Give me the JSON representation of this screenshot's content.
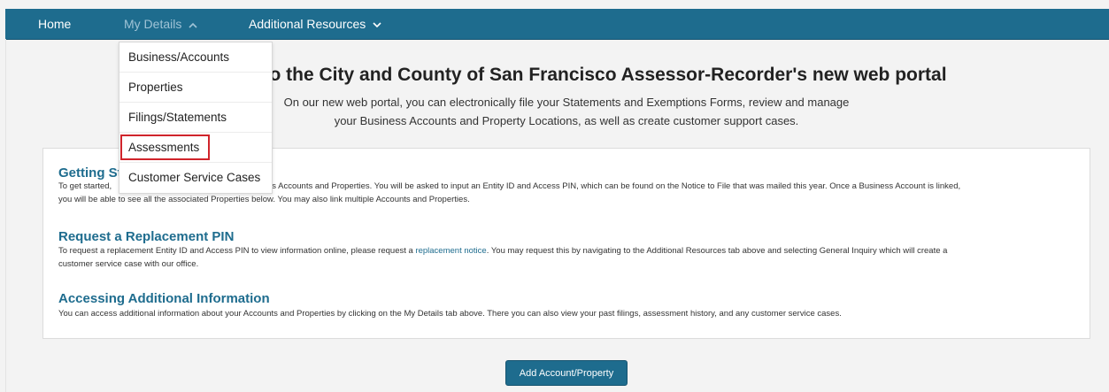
{
  "nav": {
    "home": "Home",
    "my_details": "My Details",
    "additional_resources": "Additional Resources"
  },
  "dropdown": {
    "items": [
      "Business/Accounts",
      "Properties",
      "Filings/Statements",
      "Assessments",
      "Customer Service Cases"
    ]
  },
  "welcome": {
    "title": "e to the City and County of San Francisco Assessor-Recorder's new web portal",
    "line1": "On our new web portal, you can electronically file your Statements and Exemptions Forms, review and manage",
    "line2": "your Business Accounts and Property Locations, as well as create customer support cases."
  },
  "sections": {
    "getting_started": {
      "title": "Getting St",
      "text_line1_start": "To get started,",
      "text_line1_end": "Business Accounts and Properties. You will be asked to input an Entity ID and Access PIN, which can be found on the Notice to File that was mailed this year. Once a Business Account is linked,",
      "text_line2": "you will be able to see all the associated Properties below. You may also link multiple Accounts and Properties."
    },
    "replacement_pin": {
      "title": "Request a Replacement PIN",
      "text_before_link": "To request a replacement Entity ID and Access PIN to view information online, please request a",
      "link": "replacement notice",
      "text_after_link": ". You may request this by navigating to the Additional Resources tab above and selecting General Inquiry which will create a",
      "text_line2": "customer service case with our office."
    },
    "additional_info": {
      "title": "Accessing Additional Information",
      "text": "You can access additional information about your Accounts and Properties by clicking on the My Details tab above. There you can also view your past filings, assessment history, and any customer service cases."
    }
  },
  "add_button": "Add Account/Property",
  "colors": {
    "brand": "#1e6c8e",
    "highlight": "#d0242b"
  }
}
